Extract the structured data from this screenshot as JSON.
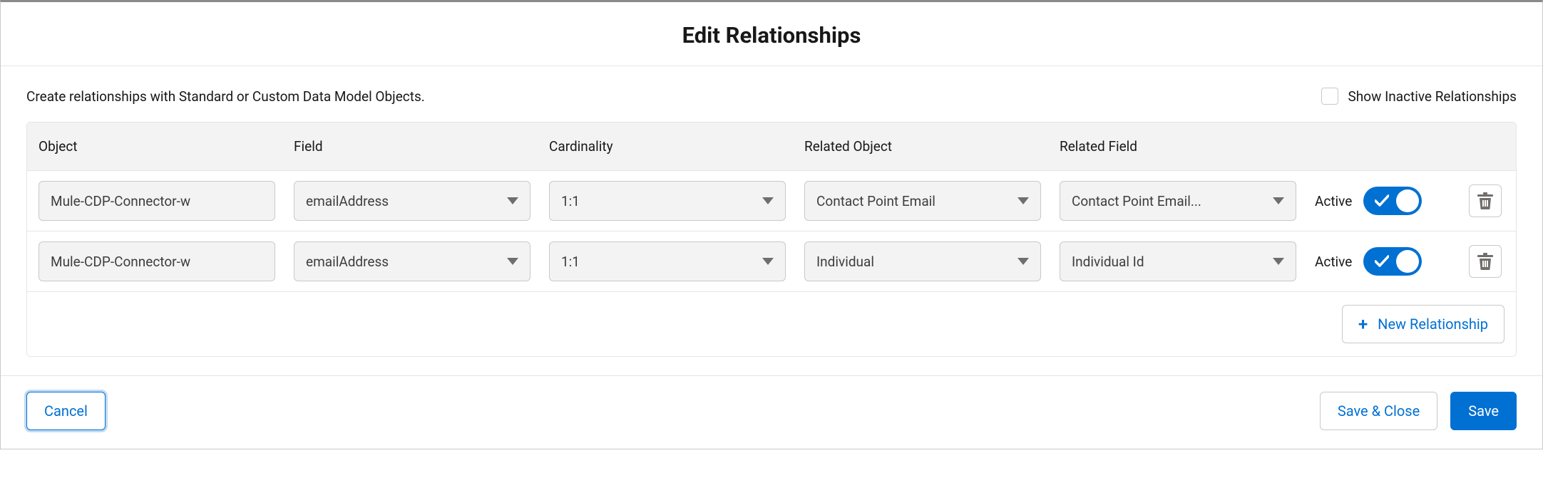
{
  "title": "Edit Relationships",
  "description": "Create relationships with Standard or Custom Data Model Objects.",
  "show_inactive": {
    "label": "Show Inactive Relationships",
    "checked": false
  },
  "columns": {
    "object": "Object",
    "field": "Field",
    "cardinality": "Cardinality",
    "related_object": "Related Object",
    "related_field": "Related Field"
  },
  "rows": [
    {
      "object": "Mule-CDP-Connector-w",
      "field": "emailAddress",
      "cardinality": "1:1",
      "related_object": "Contact Point Email",
      "related_field": "Contact Point Email...",
      "active_label": "Active",
      "active": true
    },
    {
      "object": "Mule-CDP-Connector-w",
      "field": "emailAddress",
      "cardinality": "1:1",
      "related_object": "Individual",
      "related_field": "Individual Id",
      "active_label": "Active",
      "active": true
    }
  ],
  "new_relationship_label": "New Relationship",
  "buttons": {
    "cancel": "Cancel",
    "save_close": "Save & Close",
    "save": "Save"
  }
}
